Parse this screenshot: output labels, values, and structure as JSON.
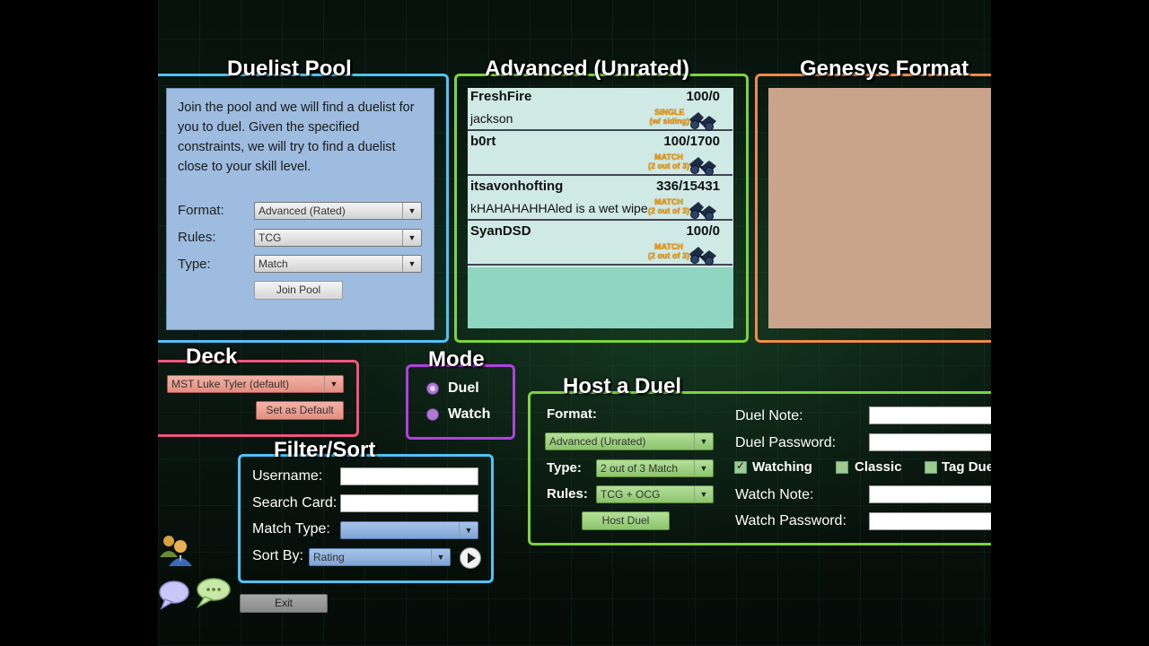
{
  "duelist_pool": {
    "title": "Duelist Pool",
    "description": "Join the pool and we will find a duelist for you to duel. Given the specified constraints, we will try to find a duelist close to your skill level.",
    "format_label": "Format:",
    "format_value": "Advanced (Rated)",
    "rules_label": "Rules:",
    "rules_value": "TCG",
    "type_label": "Type:",
    "type_value": "Match",
    "join_button": "Join Pool"
  },
  "advanced": {
    "title": "Advanced (Unrated)",
    "duels": [
      {
        "host": "FreshFire",
        "rating": "100/0",
        "note": "jackson",
        "type_line1": "SINGLE",
        "type_line2": "(w/ siding)"
      },
      {
        "host": "b0rt",
        "rating": "100/1700",
        "note": "",
        "type_line1": "MATCH",
        "type_line2": "(2 out of 3)"
      },
      {
        "host": "itsavonhofting",
        "rating": "336/15431",
        "note": "kHAHAHAHHAled is a wet wipe",
        "type_line1": "MATCH",
        "type_line2": "(2 out of 3)"
      },
      {
        "host": "SyanDSD",
        "rating": "100/0",
        "note": "",
        "type_line1": "MATCH",
        "type_line2": "(2 out of 3)"
      }
    ]
  },
  "genesys": {
    "title": "Genesys Format"
  },
  "deck": {
    "title": "Deck",
    "selected": "MST Luke Tyler (default)",
    "set_default": "Set as Default"
  },
  "mode": {
    "title": "Mode",
    "options": [
      "Duel",
      "Watch"
    ]
  },
  "filter": {
    "title": "Filter/Sort",
    "username_label": "Username:",
    "search_card_label": "Search Card:",
    "match_type_label": "Match Type:",
    "match_type_value": "",
    "sort_by_label": "Sort By:",
    "sort_by_value": "Rating"
  },
  "host": {
    "title": "Host a Duel",
    "format_label": "Format:",
    "format_value": "Advanced (Unrated)",
    "type_label": "Type:",
    "type_value": "2 out of 3 Match",
    "rules_label": "Rules:",
    "rules_value": "TCG + OCG",
    "host_button": "Host Duel",
    "duel_note_label": "Duel Note:",
    "duel_password_label": "Duel Password:",
    "watching_label": "Watching",
    "classic_label": "Classic",
    "tag_duel_label": "Tag Duel",
    "watch_note_label": "Watch Note:",
    "watch_password_label": "Watch Password:"
  },
  "exit_button": "Exit",
  "colors": {
    "pool_border": "#4fc3f7",
    "advanced_border": "#7cd43c",
    "genesys_border": "#f08a4b",
    "deck_border": "#f0557a",
    "mode_border": "#b040e0",
    "filter_border": "#4fc3f7",
    "host_border": "#7cd43c"
  },
  "icons": [
    "friends-icon",
    "chat-icon",
    "play-icon",
    "binoculars-icon",
    "dropdown-arrow-icon"
  ]
}
